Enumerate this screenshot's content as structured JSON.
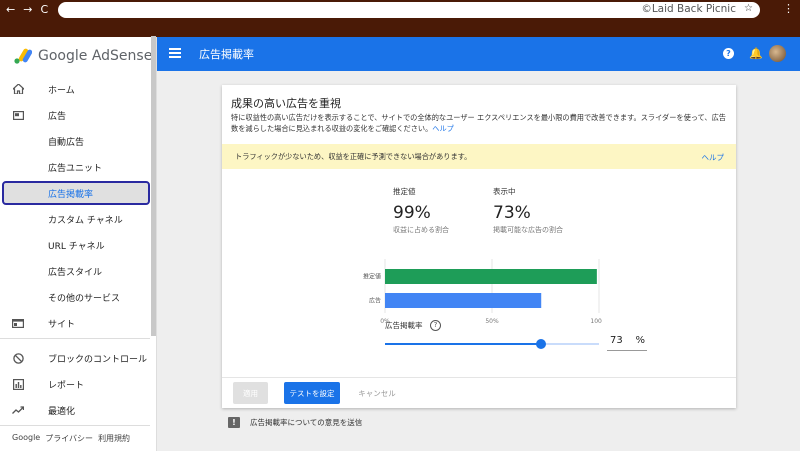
{
  "browser": {
    "url_text": "©Laid Back Picnic",
    "back": "←",
    "forward": "→",
    "reload": "C"
  },
  "sidebar": {
    "logo_text": "Google AdSense",
    "items": [
      {
        "label": "ホーム",
        "icon": "home-icon"
      },
      {
        "label": "広告",
        "icon": "ads-icon"
      },
      {
        "label": "自動広告"
      },
      {
        "label": "広告ユニット"
      },
      {
        "label": "広告掲載率"
      },
      {
        "label": "カスタム チャネル"
      },
      {
        "label": "URL チャネル"
      },
      {
        "label": "広告スタイル"
      },
      {
        "label": "その他のサービス"
      },
      {
        "label": "サイト",
        "icon": "sites-icon"
      },
      {
        "label": "ブロックのコントロール",
        "icon": "block-icon"
      },
      {
        "label": "レポート",
        "icon": "report-icon"
      },
      {
        "label": "最適化",
        "icon": "optimize-icon"
      }
    ],
    "footer": {
      "google": "Google",
      "privacy": "プライバシー",
      "terms": "利用規約"
    }
  },
  "appbar": {
    "title": "広告掲載率"
  },
  "card": {
    "title": "成果の高い広告を重視",
    "description": "特に収益性の高い広告だけを表示することで、サイトでの全体的なユーザー エクスペリエンスを最小限の費用で改善できます。スライダーを使って、広告数を減らした場合に見込まれる収益の変化をご確認ください。",
    "help_link": "ヘルプ",
    "warning": "トラフィックが少ないため、収益を正確に予測できない場合があります。",
    "warning_help": "ヘルプ",
    "metrics": [
      {
        "label": "推定値",
        "value": "99%",
        "sub": "収益に占める割合"
      },
      {
        "label": "表示中",
        "value": "73%",
        "sub": "掲載可能な広告の割合"
      }
    ],
    "slider_label": "広告掲載率",
    "slider_value": "73",
    "slider_percent": 73,
    "pct_sign": "%",
    "buttons": {
      "apply": "適用",
      "test": "テストを設定",
      "cancel": "キャンセル"
    }
  },
  "feedback": "広告掲載率についての意見を送信",
  "chart_data": {
    "type": "bar",
    "orientation": "horizontal",
    "categories": [
      "推定値",
      "広告"
    ],
    "values": [
      99,
      73
    ],
    "colors": [
      "#1e9d58",
      "#4285f4"
    ],
    "xticks": [
      "0%",
      "50%",
      "100%"
    ],
    "xlim": [
      0,
      100
    ]
  },
  "colors": {
    "brand": "#1a73e8",
    "chrome": "#4a1a06",
    "warning_bg": "#fdf6c4"
  }
}
